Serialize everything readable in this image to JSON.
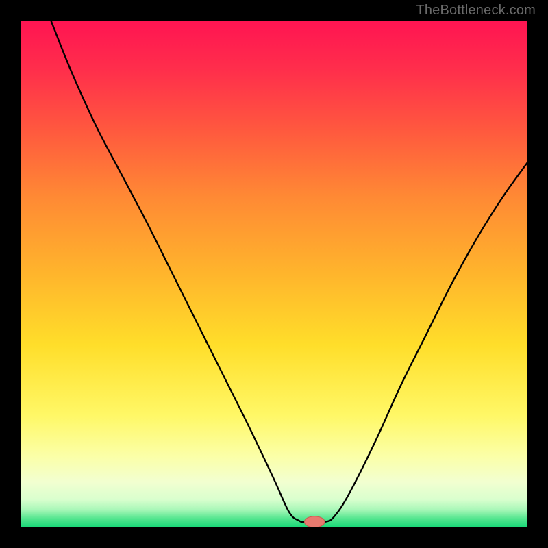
{
  "watermark": "TheBottleneck.com",
  "colors": {
    "bg": "#000000",
    "curve": "#000000",
    "marker_fill": "#e77a6f",
    "marker_stroke": "#c95b50",
    "grad_stops": [
      {
        "offset": 0.0,
        "color": "#ff1452"
      },
      {
        "offset": 0.1,
        "color": "#ff2f4b"
      },
      {
        "offset": 0.22,
        "color": "#ff5a3e"
      },
      {
        "offset": 0.35,
        "color": "#ff8a34"
      },
      {
        "offset": 0.5,
        "color": "#ffb52c"
      },
      {
        "offset": 0.64,
        "color": "#ffde2a"
      },
      {
        "offset": 0.78,
        "color": "#fff867"
      },
      {
        "offset": 0.86,
        "color": "#fbffa8"
      },
      {
        "offset": 0.91,
        "color": "#f2ffd0"
      },
      {
        "offset": 0.945,
        "color": "#d9ffce"
      },
      {
        "offset": 0.965,
        "color": "#a8f7b8"
      },
      {
        "offset": 0.982,
        "color": "#56e690"
      },
      {
        "offset": 1.0,
        "color": "#17d977"
      }
    ]
  },
  "chart_data": {
    "type": "line",
    "title": "",
    "xlabel": "",
    "ylabel": "",
    "xlim": [
      0,
      100
    ],
    "ylim": [
      0,
      100
    ],
    "grid": false,
    "legend": false,
    "series": [
      {
        "name": "bottleneck-curve",
        "x": [
          6,
          10,
          15,
          20,
          25,
          30,
          35,
          40,
          45,
          50,
          53,
          55,
          56,
          60,
          62,
          65,
          70,
          75,
          80,
          85,
          90,
          95,
          100
        ],
        "values": [
          100,
          90,
          79,
          69.5,
          60,
          50,
          40,
          30,
          20,
          9.5,
          3,
          1.3,
          1.1,
          1.1,
          2.3,
          7,
          17,
          28,
          38,
          48,
          57,
          65,
          72
        ]
      }
    ],
    "marker": {
      "x": 58,
      "y": 1.1,
      "rx": 2.0,
      "ry": 1.1
    },
    "flat_segment": {
      "x0": 55,
      "x1": 60,
      "y": 1.1
    }
  }
}
